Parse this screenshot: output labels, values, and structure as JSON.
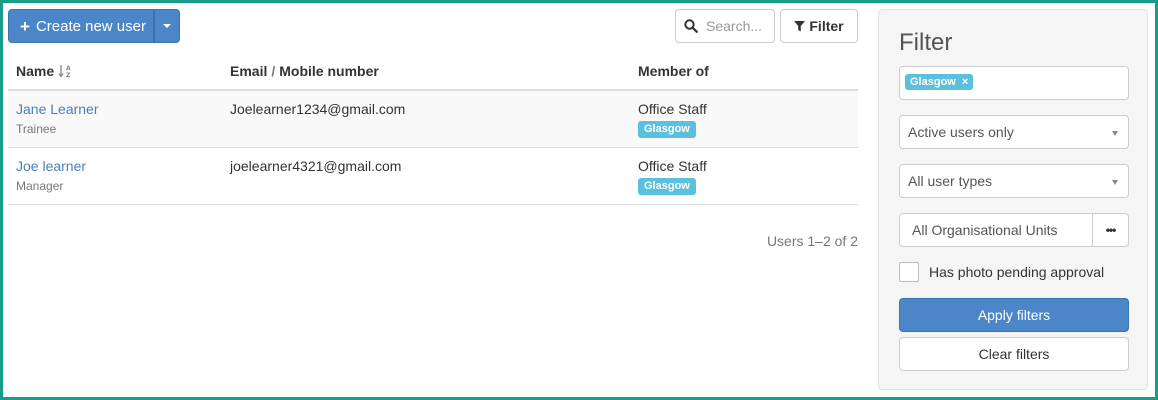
{
  "toolbar": {
    "create_label": "Create new user",
    "search_placeholder": "Search...",
    "filter_label": "Filter",
    "icons": [
      "plus-icon",
      "caret-down-icon",
      "search-icon",
      "funnel-icon"
    ]
  },
  "table": {
    "columns": {
      "name": "Name",
      "email": "Email",
      "email_sep": "/",
      "mobile": "Mobile number",
      "member": "Member of"
    },
    "rows": [
      {
        "name": "Jane Learner",
        "role": "Trainee",
        "email": "Joelearner1234@gmail.com",
        "group": "Office Staff",
        "tag": "Glasgow"
      },
      {
        "name": "Joe learner",
        "role": "Manager",
        "email": "joelearner4321@gmail.com",
        "group": "Office Staff",
        "tag": "Glasgow"
      }
    ],
    "pager": "Users 1–2 of 2"
  },
  "filter_panel": {
    "title": "Filter",
    "chip": "Glasgow",
    "chip_remove": "×",
    "status_select": "Active users only",
    "type_select": "All user types",
    "org_units": "All Organisational Units",
    "org_button": "•••",
    "photo_checkbox": "Has photo pending approval",
    "apply": "Apply filters",
    "clear": "Clear filters"
  },
  "colors": {
    "primary": "#4a86c8",
    "tag": "#5bc0de",
    "link": "#4a7fb8",
    "frame": "#1a9c8c"
  }
}
